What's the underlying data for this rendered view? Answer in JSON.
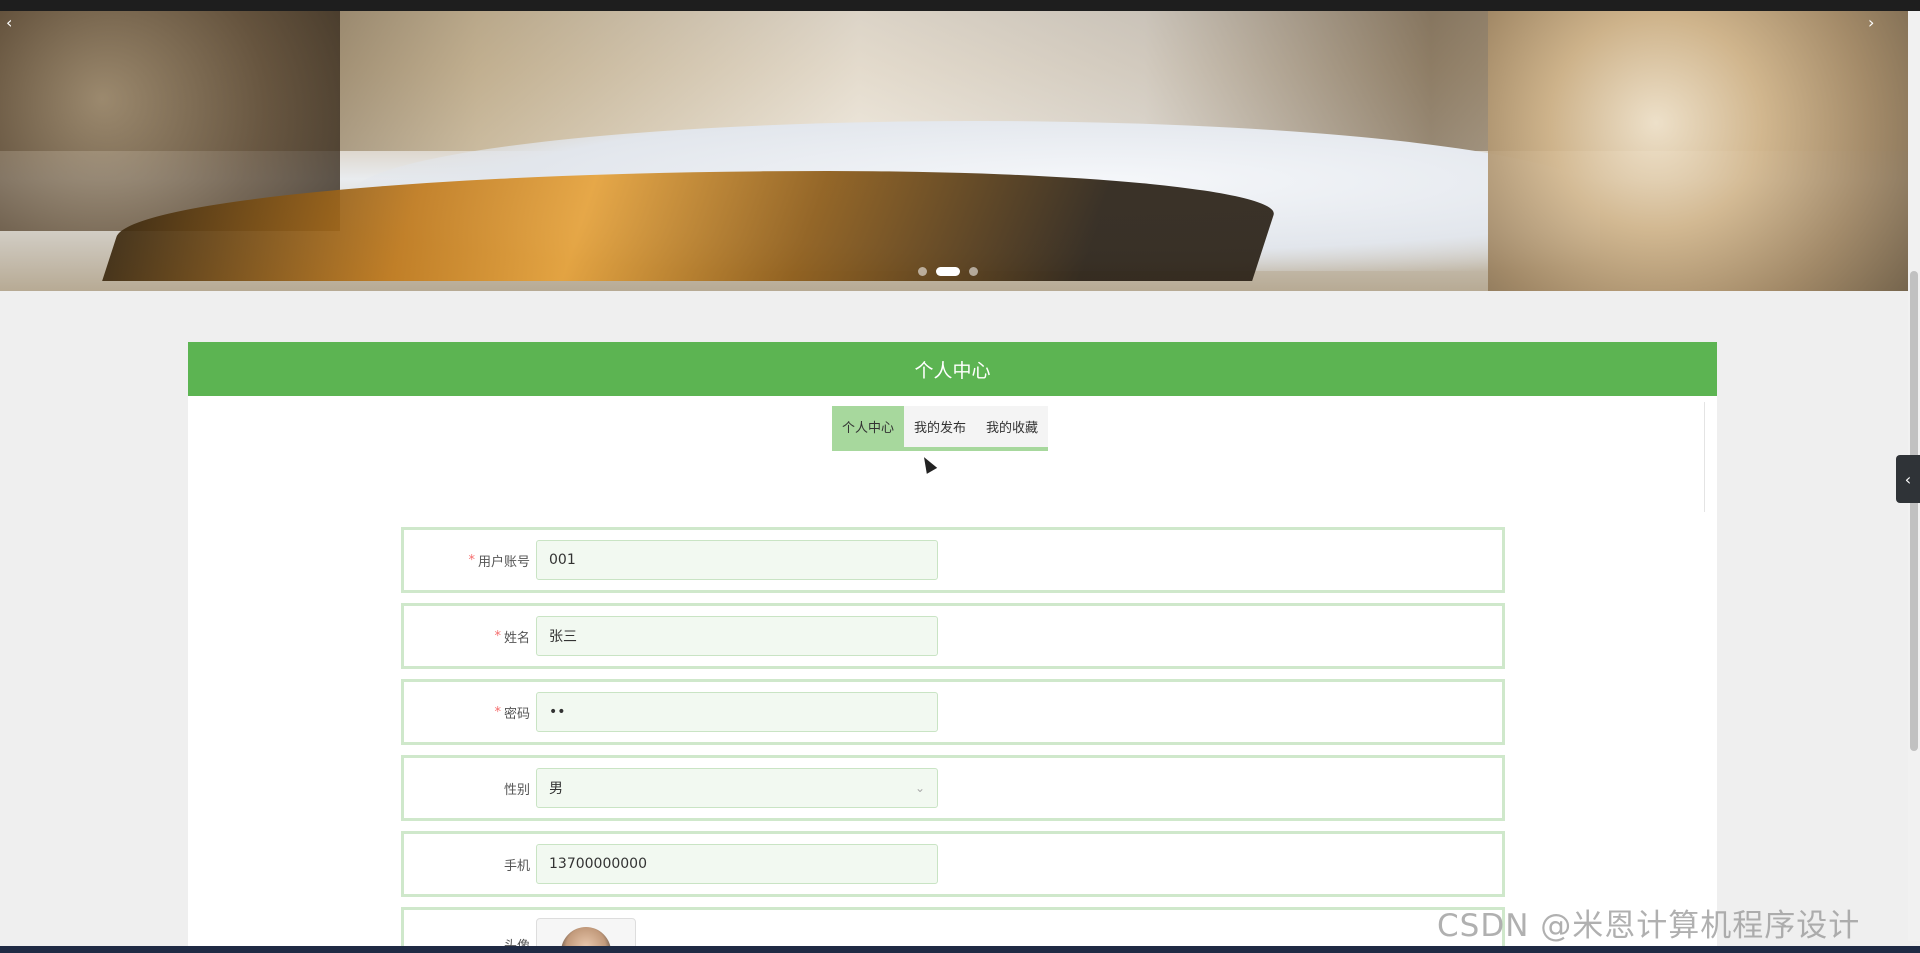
{
  "banner": {
    "prev_icon": "chevron-left-icon",
    "next_icon": "chevron-right-icon",
    "prev_glyph": "‹",
    "next_glyph": "›",
    "slides": 3,
    "active_slide": 2
  },
  "panel": {
    "title": "个人中心"
  },
  "tabs": [
    {
      "label": "个人中心",
      "active": true
    },
    {
      "label": "我的发布",
      "active": false
    },
    {
      "label": "我的收藏",
      "active": false
    }
  ],
  "form": {
    "account": {
      "label": "用户账号",
      "required": "*",
      "value": "001"
    },
    "name": {
      "label": "姓名",
      "required": "*",
      "value": "张三"
    },
    "password": {
      "label": "密码",
      "required": "*",
      "value": "••"
    },
    "gender": {
      "label": "性别",
      "value": "男"
    },
    "phone": {
      "label": "手机",
      "value": "13700000000"
    },
    "avatar": {
      "label": "头像"
    }
  },
  "side_toggle": {
    "glyph": "‹",
    "icon": "chevron-left-icon"
  },
  "watermark": "CSDN @米恩计算机程序设计",
  "colors": {
    "accent": "#5cb452",
    "tab_active": "#a7d89d",
    "field_bg": "#f2f9f1",
    "required": "#f56c6c"
  }
}
